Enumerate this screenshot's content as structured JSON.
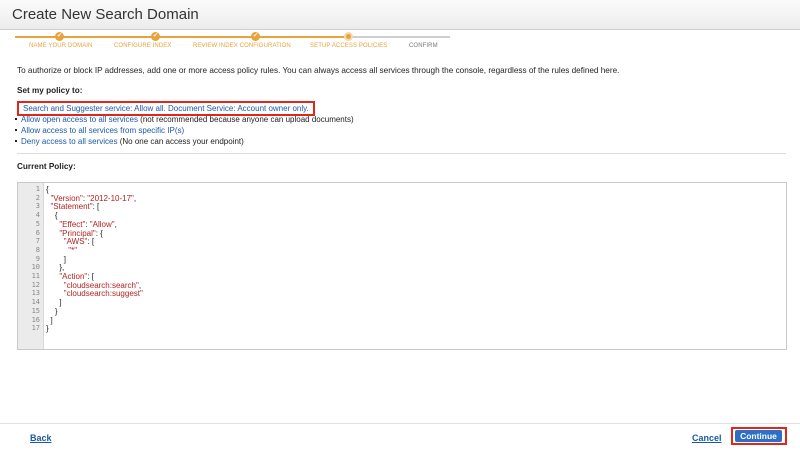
{
  "window": {
    "title": "Create New Search Domain"
  },
  "wizard": {
    "steps": [
      {
        "label": "NAME YOUR DOMAIN",
        "state": "done"
      },
      {
        "label": "CONFIGURE INDEX",
        "state": "done"
      },
      {
        "label": "REVIEW INDEX CONFIGURATION",
        "state": "done"
      },
      {
        "label": "SETUP ACCESS POLICIES",
        "state": "current"
      },
      {
        "label": "CONFIRM",
        "state": "todo"
      }
    ]
  },
  "intro": "To authorize or block IP addresses, add one or more access policy rules. You can always access all services through the console, regardless of the rules defined here.",
  "policy": {
    "heading": "Set my policy to:",
    "options": [
      {
        "link": "Search and Suggester service: Allow all. Document Service: Account owner only.",
        "note": ""
      },
      {
        "link": "Allow open access to all services",
        "note": " (not recommended because anyone can upload documents)"
      },
      {
        "link": "Allow access to all services from specific IP(s)",
        "note": ""
      },
      {
        "link": "Deny access to all services",
        "note": " (No one can access your endpoint)"
      }
    ]
  },
  "current_policy": {
    "heading": "Current Policy:",
    "line_numbers": [
      "1",
      "2",
      "3",
      "4",
      "5",
      "6",
      "7",
      "8",
      "9",
      "10",
      "11",
      "12",
      "13",
      "14",
      "15",
      "16",
      "17"
    ],
    "lines": [
      "{",
      "  \"Version\": \"2012-10-17\",",
      "  \"Statement\": [",
      "    {",
      "      \"Effect\": \"Allow\",",
      "      \"Principal\": {",
      "        \"AWS\": [",
      "          \"*\"",
      "        ]",
      "      },",
      "      \"Action\": [",
      "        \"cloudsearch:search\",",
      "        \"cloudsearch:suggest\"",
      "      ]",
      "    }",
      "  ]",
      "}"
    ]
  },
  "footer": {
    "back_label": "Back",
    "cancel_label": "Cancel",
    "continue_label": "Continue"
  }
}
